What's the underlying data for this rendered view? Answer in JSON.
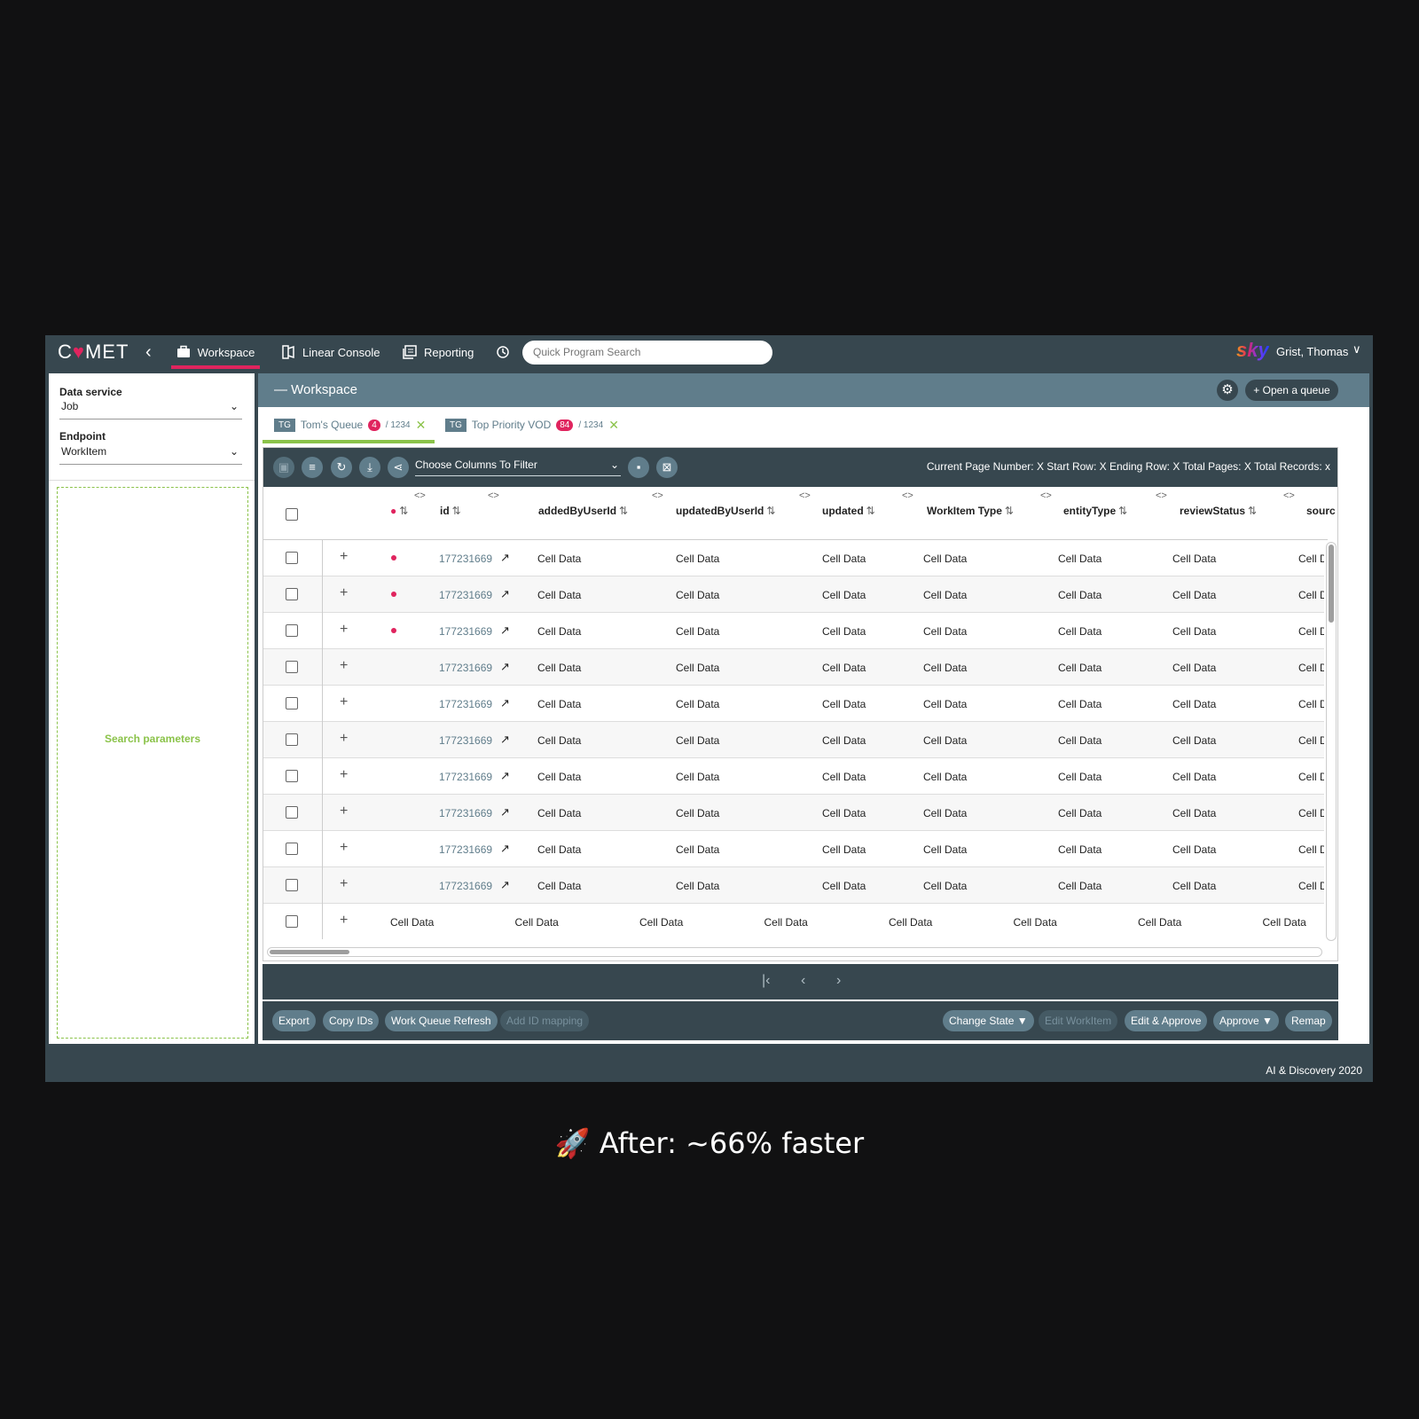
{
  "app": {
    "logo": "C♥MET",
    "footer": "AI & Discovery 2020"
  },
  "nav": {
    "tabs": [
      {
        "label": "Workspace",
        "icon": "briefcase-icon"
      },
      {
        "label": "Linear Console",
        "icon": "console-icon"
      },
      {
        "label": "Reporting",
        "icon": "report-icon"
      }
    ],
    "history_icon": "clock-icon",
    "search_placeholder": "Quick Program Search",
    "brand": "sky",
    "user": "Grist, Thomas"
  },
  "left": {
    "data_service_label": "Data service",
    "data_service_value": "Job",
    "endpoint_label": "Endpoint",
    "endpoint_value": "WorkItem",
    "search_params": "Search parameters"
  },
  "workspace": {
    "title": "Workspace",
    "open_queue": "+ Open a queue",
    "queues": [
      {
        "tag": "TG",
        "name": "Tom's Queue",
        "count": "4",
        "total": "/ 1234"
      },
      {
        "tag": "TG",
        "name": "Top Priority VOD",
        "count": "84",
        "total": "/ 1234"
      }
    ]
  },
  "toolbar": {
    "filter_placeholder": "Choose Columns To Filter",
    "page_info": "Current Page Number: X Start Row: X Ending Row: X Total Pages: X Total Records: x"
  },
  "table": {
    "columns": [
      "id",
      "addedByUserId",
      "updatedByUserId",
      "updated",
      "WorkItem Type",
      "entityType",
      "reviewStatus",
      "sourc"
    ],
    "id_value": "177231669",
    "cell": "Cell Data",
    "cell_cut": "Cell D",
    "rows_with_dot": 3,
    "id_rows": 10,
    "plain_row_cells": [
      "Cell Data",
      "Cell Data",
      "Cell Data",
      "Cell Data",
      "Cell Data",
      "Cell Data",
      "Cell Data",
      "Cell Data"
    ]
  },
  "actions": {
    "left": [
      "Export",
      "Copy IDs",
      "Work Queue Refresh",
      "Add ID mapping"
    ],
    "right": [
      "Change State ▼",
      "Edit WorkItem",
      "Edit & Approve",
      "Approve ▼",
      "Remap"
    ]
  },
  "caption": "🚀 After: ~66% faster",
  "colors": {
    "accent": "#e0245e",
    "green": "#8bc34a",
    "header": "#607d8b",
    "dark": "#37474f"
  }
}
